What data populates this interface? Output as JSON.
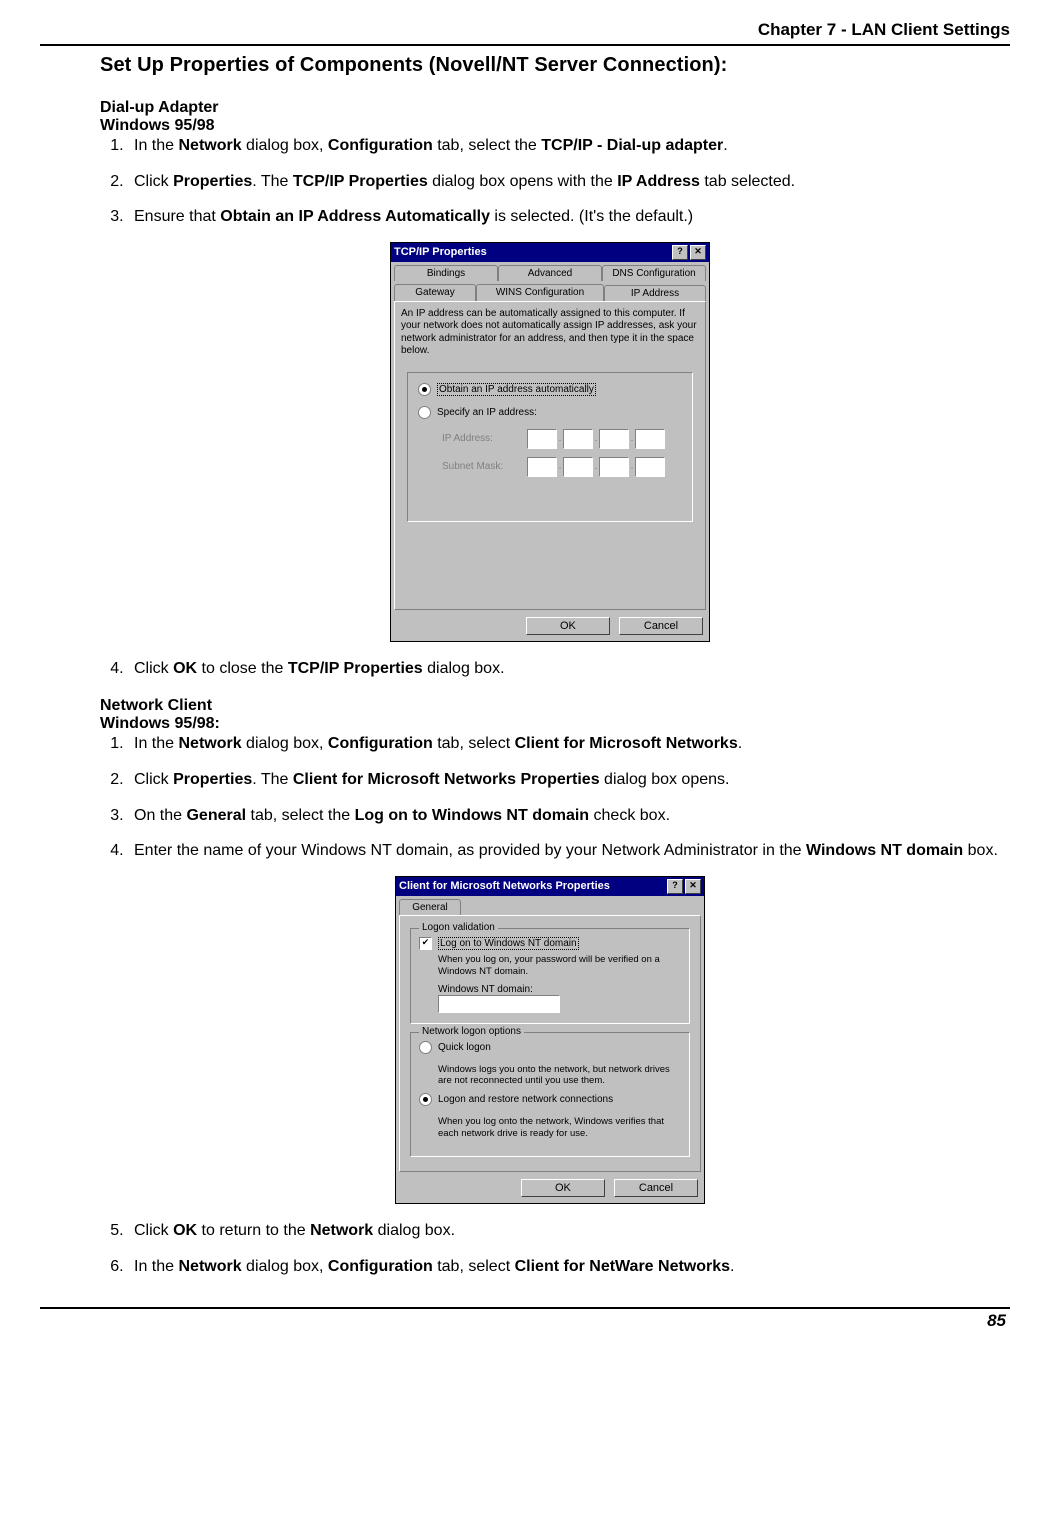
{
  "chapter_header": "Chapter 7 - LAN Client Settings",
  "section_title": "Set Up Properties of Components (Novell/NT Server Connection):",
  "dialup": {
    "h1": "Dial-up Adapter",
    "h2": "Windows 95/98",
    "steps": {
      "s1": {
        "pre": "In the ",
        "b1": "Network",
        "mid1": " dialog box, ",
        "b2": "Configuration",
        "mid2": " tab, select the ",
        "b3": "TCP/IP - Dial-up adapter",
        "post": "."
      },
      "s2": {
        "pre": "Click ",
        "b1": "Properties",
        "mid1": ". The ",
        "b2": "TCP/IP Properties",
        "mid2": " dialog box opens with the  ",
        "b3": "IP Address",
        "post": " tab selected."
      },
      "s3": {
        "pre": "Ensure that ",
        "b1": "Obtain an IP Address Automatically",
        "post": " is selected. (It's the default.)"
      },
      "s4": {
        "pre": "Click ",
        "b1": "OK",
        "mid1": " to close the ",
        "b2": "TCP/IP Properties",
        "post": " dialog box."
      }
    }
  },
  "dlg1": {
    "title": "TCP/IP Properties",
    "help_btn": "?",
    "close_btn": "✕",
    "tabs_row1": {
      "t1": "Bindings",
      "t2": "Advanced",
      "t3": "DNS Configuration"
    },
    "tabs_row2": {
      "t1": "Gateway",
      "t2": "WINS Configuration",
      "t3": "IP Address"
    },
    "helptext": "An IP address can be automatically assigned to this computer. If your network does not automatically assign IP addresses, ask your network administrator for an address, and then type it in the space below.",
    "radio_auto": "Obtain an IP address automatically",
    "radio_spec": "Specify an IP address:",
    "ip_label": "IP Address:",
    "mask_label": "Subnet Mask:",
    "ok": "OK",
    "cancel": "Cancel"
  },
  "netclient": {
    "h1": "Network Client",
    "h2": "Windows 95/98:",
    "steps": {
      "s1": {
        "pre": "In the ",
        "b1": "Network",
        "mid1": " dialog box, ",
        "b2": "Configuration",
        "mid2": " tab, select ",
        "b3": "Client for Microsoft Networks",
        "post": "."
      },
      "s2": {
        "pre": "Click ",
        "b1": "Properties",
        "mid1": ". The ",
        "b2": "Client for Microsoft Networks Properties",
        "post": " dialog box opens."
      },
      "s3": {
        "pre": " On the ",
        "b1": "General",
        "mid1": " tab, select the ",
        "b2": "Log on to Windows NT domain",
        "post": " check box."
      },
      "s4": {
        "pre": " Enter the name of your Windows NT domain, as provided by your Network Administrator in the ",
        "b1": "Windows NT domain",
        "post": " box."
      },
      "s5": {
        "pre": "Click ",
        "b1": "OK",
        "mid1": " to return to the ",
        "b2": "Network",
        "post": " dialog box."
      },
      "s6": {
        "pre": "In the ",
        "b1": "Network",
        "mid1": " dialog box, ",
        "b2": "Configuration",
        "mid2": " tab, select ",
        "b3": "Client for NetWare Networks",
        "post": "."
      }
    }
  },
  "dlg2": {
    "title": "Client for Microsoft Networks Properties",
    "help_btn": "?",
    "close_btn": "✕",
    "tab": "General",
    "grp1_legend": "Logon validation",
    "chk_label": "Log on to Windows NT domain",
    "chk_desc": "When you log on, your password will be verified on a Windows NT domain.",
    "domain_label": "Windows NT domain:",
    "grp2_legend": "Network logon options",
    "r1_label": "Quick logon",
    "r1_desc": "Windows logs you onto the network, but network drives are not reconnected until you use them.",
    "r2_label": "Logon and restore network connections",
    "r2_desc": "When you log onto the network, Windows verifies that each network drive is ready for use.",
    "ok": "OK",
    "cancel": "Cancel"
  },
  "page_number": "85"
}
